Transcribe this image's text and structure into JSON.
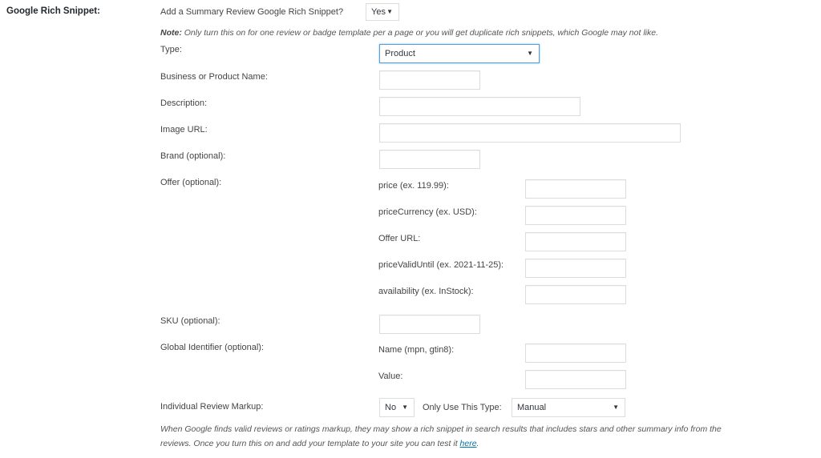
{
  "section": {
    "title": "Google Rich Snippet:"
  },
  "summary_review": {
    "question": "Add a Summary Review Google Rich Snippet?",
    "selected": "Yes",
    "note_bold": "Note:",
    "note_text": " Only turn this on for one review or badge template per a page or you will get duplicate rich snippets, which Google may not like."
  },
  "fields": {
    "type": {
      "label": "Type:",
      "selected": "Product"
    },
    "name": {
      "label": "Business or Product Name:",
      "value": ""
    },
    "description": {
      "label": "Description:",
      "value": ""
    },
    "image_url": {
      "label": "Image URL:",
      "value": ""
    },
    "brand": {
      "label": "Brand (optional):",
      "value": ""
    },
    "offer": {
      "label": "Offer (optional):",
      "price": {
        "label": "price (ex. 119.99):",
        "value": ""
      },
      "price_currency": {
        "label": "priceCurrency (ex. USD):",
        "value": ""
      },
      "offer_url": {
        "label": "Offer URL:",
        "value": ""
      },
      "price_valid_until": {
        "label": "priceValidUntil (ex. 2021-11-25):",
        "value": ""
      },
      "availability": {
        "label": "availability (ex. InStock):",
        "value": ""
      }
    },
    "sku": {
      "label": "SKU (optional):",
      "value": ""
    },
    "global_identifier": {
      "label": "Global Identifier (optional):",
      "name": {
        "label": "Name (mpn, gtin8):",
        "value": ""
      },
      "value": {
        "label": "Value:",
        "value": ""
      }
    },
    "individual_review": {
      "label": "Individual Review Markup:",
      "selected": "No",
      "only_type_label": "Only Use This Type:",
      "only_type_selected": "Manual"
    }
  },
  "help": {
    "line1": "When Google finds valid reviews or ratings markup, they may show a rich snippet in search results that includes stars and other summary info from the",
    "line2_pre": "reviews. Once you turn this on and add your template to your site you can test it ",
    "link": "here",
    "line2_post": "."
  }
}
